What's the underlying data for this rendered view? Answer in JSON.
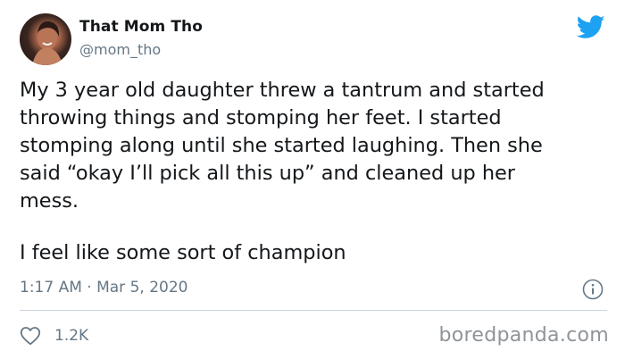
{
  "author": {
    "display_name": "That Mom Tho",
    "handle": "@mom_tho"
  },
  "tweet": {
    "text": "My 3 year old daughter threw a tantrum and started\nthrowing things and stomping her feet. I started\nstomping along until she started laughing. Then she\nsaid “okay I’ll pick all this up” and cleaned up her\nmess.",
    "text_2": "I feel like some sort of champion",
    "timestamp": "1:17 AM · Mar 5, 2020",
    "like_count": "1.2K"
  },
  "watermark": "boredpanda.com",
  "icons": {
    "brand": "twitter-bird-icon",
    "info": "info-icon",
    "like": "heart-icon"
  },
  "colors": {
    "twitter_blue": "#1da1f2",
    "secondary_text": "#657786",
    "divider": "#ccd6dd"
  }
}
